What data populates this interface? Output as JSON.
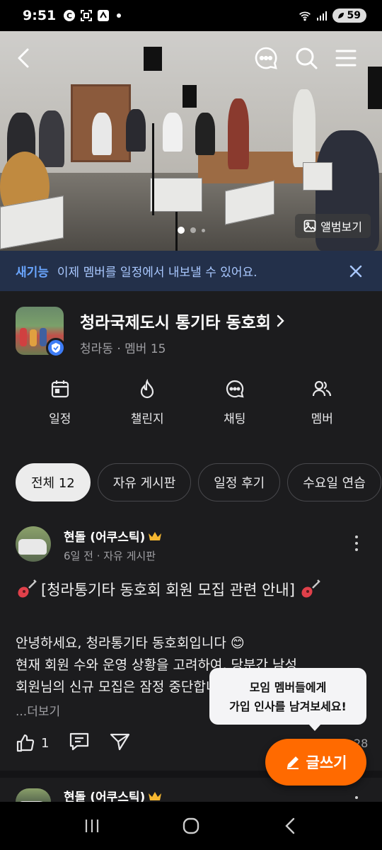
{
  "status_bar": {
    "time": "9:51",
    "battery": "59"
  },
  "hero": {
    "album_label": "앨범보기",
    "page_count": 3,
    "active_page": 1
  },
  "banner": {
    "badge": "새기능",
    "text": "이제 멤버를 일정에서 내보낼 수 있어요."
  },
  "group": {
    "name": "청라국제도시 통기타 동호회",
    "location": "청라동",
    "member_label": "멤버 15"
  },
  "actions": [
    {
      "label": "일정",
      "icon": "calendar-icon"
    },
    {
      "label": "챌린지",
      "icon": "flame-icon"
    },
    {
      "label": "채팅",
      "icon": "chat-icon"
    },
    {
      "label": "멤버",
      "icon": "members-icon"
    }
  ],
  "tabs": [
    {
      "label": "전체 12",
      "active": true
    },
    {
      "label": "자유 게시판",
      "active": false
    },
    {
      "label": "일정 후기",
      "active": false
    },
    {
      "label": "수요일 연습",
      "active": false
    }
  ],
  "posts": [
    {
      "author": "현돌 (어쿠스틱)",
      "time": "6일 전",
      "board": "자유 게시판",
      "title": "[청라통기타 동호회 회원 모집 관련 안내]",
      "body_lines": [
        "안녕하세요, 청라통기타 동호회입니다 😊",
        "현재 회원 수와 운영 상황을 고려하여, 당분간 남성",
        "회원님의 신규 모집은 잠정 중단합니다."
      ],
      "more_label": "...더보기",
      "likes": "1",
      "comments": "28"
    },
    {
      "author": "현돌 (어쿠스틱)"
    }
  ],
  "tooltip": {
    "line1": "모임 멤버들에게",
    "line2": "가입 인사를 남겨보세요!"
  },
  "write_button": {
    "label": "글쓰기"
  },
  "colors": {
    "accent": "#ff6a00",
    "banner_bg": "#23304a",
    "badge_blue": "#6aa6ff",
    "verify": "#3d7cf6"
  }
}
